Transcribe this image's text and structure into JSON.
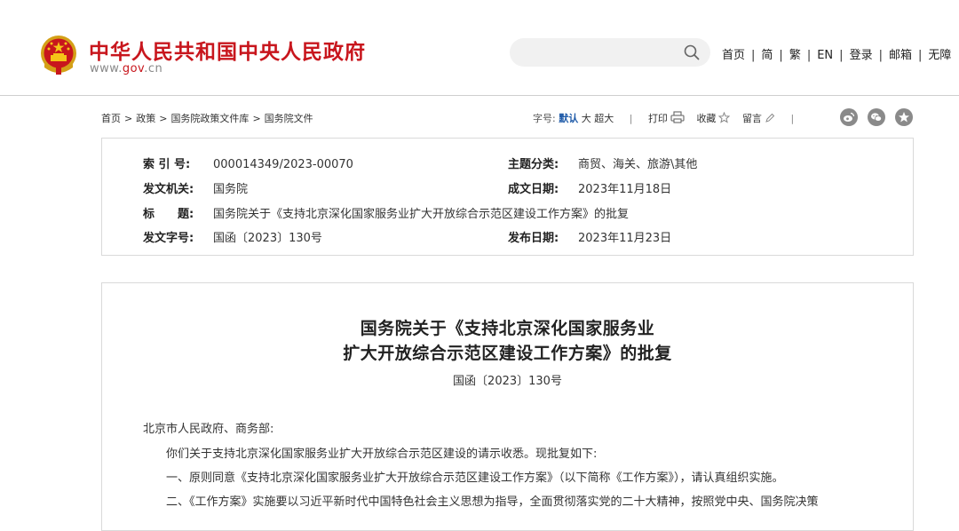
{
  "header": {
    "site_title": "中华人民共和国中央人民政府",
    "domain_prefix": "www.",
    "domain_main": "gov",
    "domain_suffix": ".cn",
    "search": {
      "placeholder": "",
      "icon": "search-icon"
    },
    "nav": [
      "首页",
      "简",
      "繁",
      "EN",
      "登录",
      "邮箱",
      "无障"
    ]
  },
  "breadcrumb": [
    "首页",
    "政策",
    "国务院政策文件库",
    "国务院文件"
  ],
  "tools": {
    "font_label": "字号:",
    "font_default": "默认",
    "font_big": "大",
    "font_bigger": "超大",
    "print": "打印",
    "favorite": "收藏",
    "comment": "留言",
    "share_icons": [
      "weibo-icon",
      "wechat-icon",
      "qzone-icon"
    ]
  },
  "meta": {
    "index_label": "索 引 号:",
    "index_value": "000014349/2023-00070",
    "category_label": "主题分类:",
    "category_value": "商贸、海关、旅游\\其他",
    "issuer_label": "发文机关:",
    "issuer_value": "国务院",
    "date_made_label": "成文日期:",
    "date_made_value": "2023年11月18日",
    "title_label": "标　　题:",
    "title_value": "国务院关于《支持北京深化国家服务业扩大开放综合示范区建设工作方案》的批复",
    "docno_label": "发文字号:",
    "docno_value": "国函〔2023〕130号",
    "publish_label": "发布日期:",
    "publish_value": "2023年11月23日"
  },
  "document": {
    "title_line1": "国务院关于《支持北京深化国家服务业",
    "title_line2": "扩大开放综合示范区建设工作方案》的批复",
    "doc_no": "国函〔2023〕130号",
    "salutation": "北京市人民政府、商务部:",
    "para1": "你们关于支持北京深化国家服务业扩大开放综合示范区建设的请示收悉。现批复如下:",
    "para2": "一、原则同意《支持北京深化国家服务业扩大开放综合示范区建设工作方案》（以下简称《工作方案》），请认真组织实施。",
    "para3": "二、《工作方案》实施要以习近平新时代中国特色社会主义思想为指导，全面贯彻落实党的二十大精神，按照党中央、国务院决策"
  },
  "colors": {
    "brand_red": "#c8161d",
    "link_blue": "#1e5aa8",
    "border": "#d9d9d9"
  }
}
